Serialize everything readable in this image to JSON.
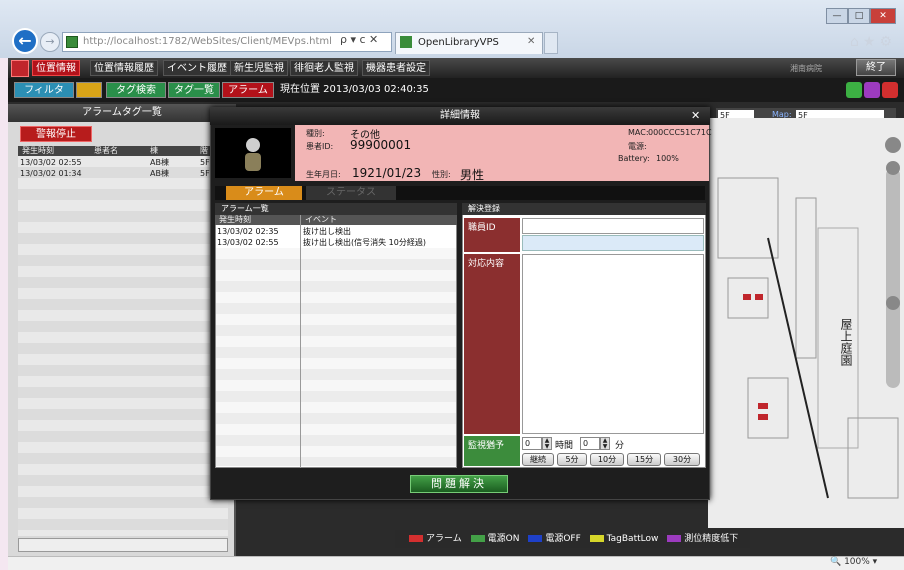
{
  "browser": {
    "address": "http://localhost:1782/WebSites/Client/MEVps.html",
    "address_host": "localhost",
    "address_ctrl": "ρ ▾ c ✕",
    "tab_title": "OpenLibraryVPS",
    "zoom": "100%"
  },
  "menu": {
    "items": [
      "位置情報",
      "位置情報履歴",
      "イベント履歴",
      "新生児監視",
      "徘徊老人監視",
      "機器患者設定"
    ],
    "active_index": 0,
    "hospital": "湘南病院",
    "end_label": "終了"
  },
  "toolbar": {
    "filter": "フィルタ",
    "search": "タグ検索",
    "list": "タグ一覧",
    "alarm": "アラーム",
    "current_position": "現在位置 2013/03/03 02:40:35"
  },
  "left_panel": {
    "title": "アラームタグ一覧",
    "stop_button": "警報停止",
    "columns": [
      "発生時刻",
      "患者名",
      "棟",
      "階"
    ],
    "rows": [
      {
        "time": "13/03/02 02:55",
        "name": "",
        "building": "AB棟",
        "floor": "5F"
      },
      {
        "time": "13/03/02 01:34",
        "name": "",
        "building": "AB棟",
        "floor": "5F"
      }
    ]
  },
  "map": {
    "floor": "5F",
    "map_label": "Map:",
    "map_value": "5F",
    "building_label": "屋上庭園"
  },
  "legend": [
    {
      "label": "アラーム",
      "color": "#d32f2f"
    },
    {
      "label": "電源ON",
      "color": "#43a047"
    },
    {
      "label": "電源OFF",
      "color": "#1e40c8"
    },
    {
      "label": "TagBattLow",
      "color": "#d6d62a"
    },
    {
      "label": "測位精度低下",
      "color": "#9c3bbf"
    }
  ],
  "dialog": {
    "title": "詳細情報",
    "type_label": "種別:",
    "type_value": "その他",
    "patient_label": "患者ID:",
    "patient_value": "99900001",
    "birth_label": "生年月日:",
    "birth_value": "1921/01/23",
    "sex_label": "性別:",
    "sex_value": "男性",
    "mac_label": "MAC:",
    "mac_value": "000CCC51C71C",
    "power_label": "電源:",
    "battery_label": "Battery:",
    "battery_value": "100%",
    "tabs": [
      "アラーム",
      "ステータス"
    ],
    "alarm_list": {
      "title": "アラーム一覧",
      "columns": [
        "発生時刻",
        "イベント"
      ],
      "rows": [
        {
          "time": "13/03/02 02:35",
          "event": "抜け出し検出"
        },
        {
          "time": "13/03/02 02:55",
          "event": "抜け出し検出(信号消失 10分経過)"
        }
      ]
    },
    "resolution": {
      "title": "解決登録",
      "staff_label": "職員ID",
      "content_label": "対応内容",
      "grace_label": "監視猶予",
      "hours_value": "0",
      "hours_label": "時間",
      "minutes_value": "0",
      "minutes_label": "分",
      "presets": [
        "継続",
        "5分",
        "10分",
        "15分",
        "30分"
      ]
    },
    "solve_button": "問題解決"
  },
  "colors": {
    "accent_red": "#b3121a",
    "info_pink": "#f2b5b5",
    "tab_orange": "#d98c1a",
    "grace_green": "#3c8c3c"
  }
}
